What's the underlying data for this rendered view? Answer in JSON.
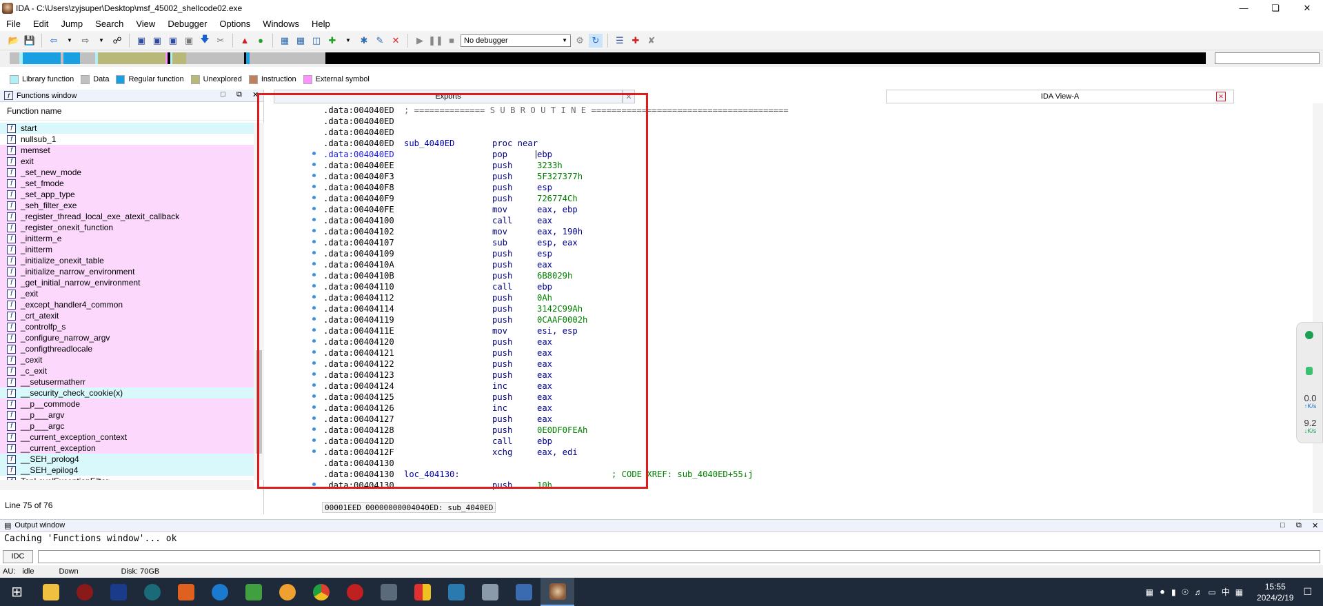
{
  "window": {
    "title": "IDA - C:\\Users\\zyjsuper\\Desktop\\msf_45002_shellcode02.exe"
  },
  "menu": [
    "File",
    "Edit",
    "Jump",
    "Search",
    "View",
    "Debugger",
    "Options",
    "Windows",
    "Help"
  ],
  "toolbar": {
    "debugger_select": "No debugger"
  },
  "legend": [
    {
      "label": "Library function",
      "color": "#aef0f8"
    },
    {
      "label": "Data",
      "color": "#c0c0c0"
    },
    {
      "label": "Regular function",
      "color": "#1aa0e0"
    },
    {
      "label": "Unexplored",
      "color": "#b8b878"
    },
    {
      "label": "Instruction",
      "color": "#c08060"
    },
    {
      "label": "External symbol",
      "color": "#ff90ff"
    }
  ],
  "functions_window": {
    "title": "Functions window",
    "column": "Function name",
    "status": "Line 75 of 76",
    "items": [
      {
        "name": "start",
        "kind": "lib"
      },
      {
        "name": "nullsub_1",
        "kind": "plain"
      },
      {
        "name": "memset",
        "kind": "ext"
      },
      {
        "name": "exit",
        "kind": "ext"
      },
      {
        "name": "_set_new_mode",
        "kind": "ext"
      },
      {
        "name": "_set_fmode",
        "kind": "ext"
      },
      {
        "name": "_set_app_type",
        "kind": "ext"
      },
      {
        "name": "_seh_filter_exe",
        "kind": "ext"
      },
      {
        "name": "_register_thread_local_exe_atexit_callback",
        "kind": "ext"
      },
      {
        "name": "_register_onexit_function",
        "kind": "ext"
      },
      {
        "name": "_initterm_e",
        "kind": "ext"
      },
      {
        "name": "_initterm",
        "kind": "ext"
      },
      {
        "name": "_initialize_onexit_table",
        "kind": "ext"
      },
      {
        "name": "_initialize_narrow_environment",
        "kind": "ext"
      },
      {
        "name": "_get_initial_narrow_environment",
        "kind": "ext"
      },
      {
        "name": "_exit",
        "kind": "ext"
      },
      {
        "name": "_except_handler4_common",
        "kind": "ext"
      },
      {
        "name": "_crt_atexit",
        "kind": "ext"
      },
      {
        "name": "_controlfp_s",
        "kind": "ext"
      },
      {
        "name": "_configure_narrow_argv",
        "kind": "ext"
      },
      {
        "name": "_configthreadlocale",
        "kind": "ext"
      },
      {
        "name": "_cexit",
        "kind": "ext"
      },
      {
        "name": "_c_exit",
        "kind": "ext"
      },
      {
        "name": "__setusermatherr",
        "kind": "ext"
      },
      {
        "name": "__security_check_cookie(x)",
        "kind": "lib"
      },
      {
        "name": "__p__commode",
        "kind": "ext"
      },
      {
        "name": "__p___argv",
        "kind": "ext"
      },
      {
        "name": "__p___argc",
        "kind": "ext"
      },
      {
        "name": "__current_exception_context",
        "kind": "ext"
      },
      {
        "name": "__current_exception",
        "kind": "ext"
      },
      {
        "name": "__SEH_prolog4",
        "kind": "lib"
      },
      {
        "name": "__SEH_epilog4",
        "kind": "lib"
      },
      {
        "name": "TopLevelExceptionFilter",
        "kind": "plain"
      }
    ]
  },
  "tabs": {
    "exports": "Exports",
    "ida_view": "IDA View-A"
  },
  "disasm": {
    "lines": [
      {
        "addr": ".data:004040ED",
        "label": "",
        "mn": "",
        "op": "",
        "extra": "; ============== S U B R O U T I N E =======================================",
        "dot": false
      },
      {
        "addr": ".data:004040ED",
        "label": "",
        "mn": "",
        "op": "",
        "extra": "",
        "dot": false
      },
      {
        "addr": ".data:004040ED",
        "label": "",
        "mn": "",
        "op": "",
        "extra": "",
        "dot": false
      },
      {
        "addr": ".data:004040ED",
        "label": "sub_4040ED",
        "mn": "proc near",
        "op": "",
        "extra": "",
        "dot": false
      },
      {
        "addr": ".data:004040ED",
        "label": "",
        "mn": "pop",
        "op": "ebp",
        "extra": "",
        "dot": true,
        "hl": true
      },
      {
        "addr": ".data:004040EE",
        "label": "",
        "mn": "push",
        "op": "3233h",
        "extra": "",
        "dot": true,
        "num": true
      },
      {
        "addr": ".data:004040F3",
        "label": "",
        "mn": "push",
        "op": "5F327377h",
        "extra": "",
        "dot": true,
        "num": true
      },
      {
        "addr": ".data:004040F8",
        "label": "",
        "mn": "push",
        "op": "esp",
        "extra": "",
        "dot": true
      },
      {
        "addr": ".data:004040F9",
        "label": "",
        "mn": "push",
        "op": "726774Ch",
        "extra": "",
        "dot": true,
        "num": true
      },
      {
        "addr": ".data:004040FE",
        "label": "",
        "mn": "mov",
        "op": "eax, ebp",
        "extra": "",
        "dot": true
      },
      {
        "addr": ".data:00404100",
        "label": "",
        "mn": "call",
        "op": "eax",
        "extra": "",
        "dot": true
      },
      {
        "addr": ".data:00404102",
        "label": "",
        "mn": "mov",
        "op": "eax, 190h",
        "extra": "",
        "dot": true
      },
      {
        "addr": ".data:00404107",
        "label": "",
        "mn": "sub",
        "op": "esp, eax",
        "extra": "",
        "dot": true
      },
      {
        "addr": ".data:00404109",
        "label": "",
        "mn": "push",
        "op": "esp",
        "extra": "",
        "dot": true
      },
      {
        "addr": ".data:0040410A",
        "label": "",
        "mn": "push",
        "op": "eax",
        "extra": "",
        "dot": true
      },
      {
        "addr": ".data:0040410B",
        "label": "",
        "mn": "push",
        "op": "6B8029h",
        "extra": "",
        "dot": true,
        "num": true
      },
      {
        "addr": ".data:00404110",
        "label": "",
        "mn": "call",
        "op": "ebp",
        "extra": "",
        "dot": true
      },
      {
        "addr": ".data:00404112",
        "label": "",
        "mn": "push",
        "op": "0Ah",
        "extra": "",
        "dot": true,
        "num": true
      },
      {
        "addr": ".data:00404114",
        "label": "",
        "mn": "push",
        "op": "3142C99Ah",
        "extra": "",
        "dot": true,
        "num": true
      },
      {
        "addr": ".data:00404119",
        "label": "",
        "mn": "push",
        "op": "0CAAF0002h",
        "extra": "",
        "dot": true,
        "num": true
      },
      {
        "addr": ".data:0040411E",
        "label": "",
        "mn": "mov",
        "op": "esi, esp",
        "extra": "",
        "dot": true
      },
      {
        "addr": ".data:00404120",
        "label": "",
        "mn": "push",
        "op": "eax",
        "extra": "",
        "dot": true
      },
      {
        "addr": ".data:00404121",
        "label": "",
        "mn": "push",
        "op": "eax",
        "extra": "",
        "dot": true
      },
      {
        "addr": ".data:00404122",
        "label": "",
        "mn": "push",
        "op": "eax",
        "extra": "",
        "dot": true
      },
      {
        "addr": ".data:00404123",
        "label": "",
        "mn": "push",
        "op": "eax",
        "extra": "",
        "dot": true
      },
      {
        "addr": ".data:00404124",
        "label": "",
        "mn": "inc",
        "op": "eax",
        "extra": "",
        "dot": true
      },
      {
        "addr": ".data:00404125",
        "label": "",
        "mn": "push",
        "op": "eax",
        "extra": "",
        "dot": true
      },
      {
        "addr": ".data:00404126",
        "label": "",
        "mn": "inc",
        "op": "eax",
        "extra": "",
        "dot": true
      },
      {
        "addr": ".data:00404127",
        "label": "",
        "mn": "push",
        "op": "eax",
        "extra": "",
        "dot": true
      },
      {
        "addr": ".data:00404128",
        "label": "",
        "mn": "push",
        "op": "0E0DF0FEAh",
        "extra": "",
        "dot": true,
        "num": true
      },
      {
        "addr": ".data:0040412D",
        "label": "",
        "mn": "call",
        "op": "ebp",
        "extra": "",
        "dot": true
      },
      {
        "addr": ".data:0040412F",
        "label": "",
        "mn": "xchg",
        "op": "eax, edi",
        "extra": "",
        "dot": true
      },
      {
        "addr": ".data:00404130",
        "label": "",
        "mn": "",
        "op": "",
        "extra": "",
        "dot": false
      },
      {
        "addr": ".data:00404130",
        "label": "loc_404130:",
        "mn": "",
        "op": "",
        "extra": "; CODE XREF: sub_4040ED+55↓j",
        "dot": false
      },
      {
        "addr": ".data:00404130",
        "label": "",
        "mn": "push",
        "op": "10h",
        "extra": "",
        "dot": true,
        "num": true
      }
    ],
    "status_offset": "00001EED",
    "status_location": "00000000004040ED: sub_4040ED"
  },
  "output": {
    "title": "Output window",
    "text": "Caching 'Functions window'... ok",
    "idc_label": "IDC"
  },
  "status": {
    "au": "AU:",
    "au_state": "idle",
    "direction": "Down",
    "disk": "Disk: 70GB"
  },
  "widget": {
    "up": "0.0",
    "up_unit": "K/s",
    "down": "9.2",
    "down_unit": "K/s"
  },
  "clock": {
    "time": "15:55",
    "date": "2024/2/19"
  },
  "tray_lang": "中"
}
